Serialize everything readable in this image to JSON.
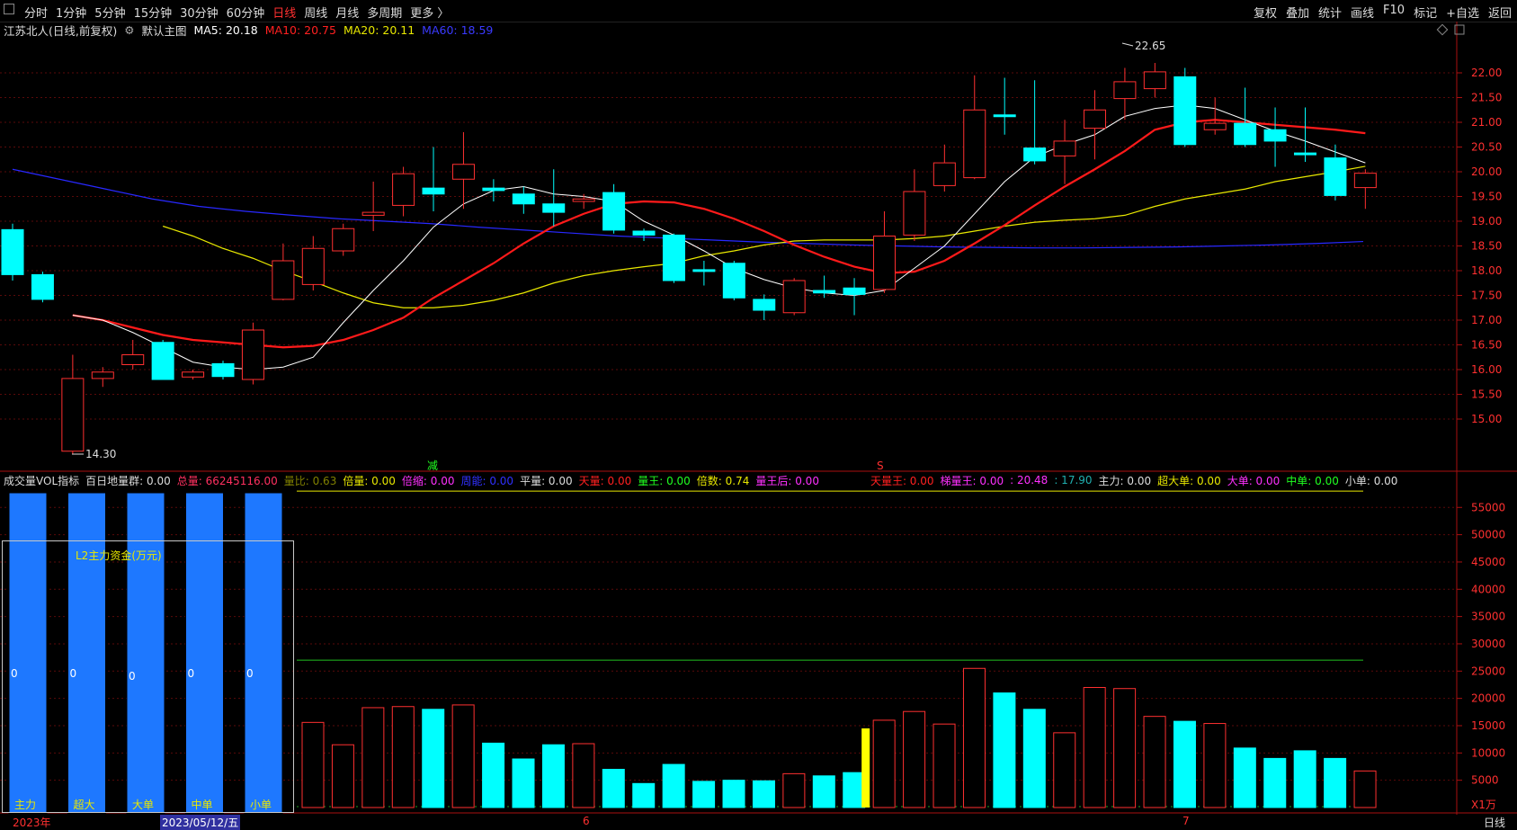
{
  "toolbar": {
    "left_tabs": [
      "分时",
      "1分钟",
      "5分钟",
      "15分钟",
      "30分钟",
      "60分钟",
      "日线",
      "周线",
      "月线",
      "多周期",
      "更多 〉"
    ],
    "active_tab": "日线",
    "right_tabs": [
      "复权",
      "叠加",
      "统计",
      "画线",
      "F10",
      "标记",
      "+自选",
      "返回"
    ]
  },
  "infobar": {
    "title": "江苏北人(日线,前复权)",
    "main_chart_label": "默认主图",
    "ma5": "MA5: 20.18",
    "ma10": "MA10: 20.75",
    "ma20": "MA20: 20.11",
    "ma60": "MA60: 18.59",
    "colors": {
      "ma5": "#ffffff",
      "ma10": "#ff2020",
      "ma20": "#e8e800",
      "ma60": "#3030ff"
    }
  },
  "price_axis": [
    "22.00",
    "21.50",
    "21.00",
    "20.50",
    "20.00",
    "19.50",
    "19.00",
    "18.50",
    "18.00",
    "17.50",
    "17.00",
    "16.50",
    "16.00",
    "15.50",
    "15.00"
  ],
  "annotations": {
    "high": "22.65",
    "low": "14.30",
    "jian": "减",
    "s": "S"
  },
  "indicator_bar": {
    "name": "成交量VOL指标",
    "items": [
      {
        "t": "百日地量群: 0.00",
        "c": "#ddd"
      },
      {
        "t": "总量: 66245116.00",
        "c": "#ff3060"
      },
      {
        "t": "量比: 0.63",
        "c": "#808000"
      },
      {
        "t": "倍量: 0.00",
        "c": "#e8e800"
      },
      {
        "t": "倍缩: 0.00",
        "c": "#ff30ff"
      },
      {
        "t": "周能: 0.00",
        "c": "#3030ff"
      },
      {
        "t": "平量: 0.00",
        "c": "#ddd"
      },
      {
        "t": "天量: 0.00",
        "c": "#ff2020"
      },
      {
        "t": "量王: 0.00",
        "c": "#20ff20"
      },
      {
        "t": "倍数: 0.74",
        "c": "#e8e800"
      },
      {
        "t": "量王后: 0.00",
        "c": "#ff30ff"
      },
      {
        "t": "天量王: 0.00",
        "c": "#ff2020"
      },
      {
        "t": "梯量王: 0.00",
        "c": "#ff30ff"
      },
      {
        "t": ": 20.48",
        "c": "#ff30ff"
      },
      {
        "t": ": 17.90",
        "c": "#20b0b0"
      },
      {
        "t": "主力: 0.00",
        "c": "#ddd"
      },
      {
        "t": "超大单: 0.00",
        "c": "#e8e800"
      },
      {
        "t": "大单: 0.00",
        "c": "#ff30ff"
      },
      {
        "t": "中单: 0.00",
        "c": "#20ff20"
      },
      {
        "t": "小单: 0.00",
        "c": "#ddd"
      }
    ]
  },
  "volume_axis": [
    "55000",
    "50000",
    "45000",
    "40000",
    "35000",
    "30000",
    "25000",
    "20000",
    "15000",
    "10000",
    "5000"
  ],
  "volume_unit": "X1万",
  "l2_panel": {
    "title": "L2主力资金(万元)",
    "bars": [
      {
        "label": "主力",
        "value": "0"
      },
      {
        "label": "超大",
        "value": "0"
      },
      {
        "label": "大单",
        "value": "0"
      },
      {
        "label": "中单",
        "value": "0"
      },
      {
        "label": "小单",
        "value": "0"
      }
    ]
  },
  "bottom": {
    "year": "2023年",
    "date": "2023/05/12/五",
    "m6": "6",
    "m7": "7",
    "period": "日线"
  },
  "chart_data": {
    "type": "candlestick",
    "y_range": [
      14.3,
      22.65
    ],
    "candles": [
      [
        18.83,
        17.92,
        18.95,
        17.8,
        "d"
      ],
      [
        17.92,
        17.42,
        17.98,
        17.36,
        "d"
      ],
      [
        15.82,
        14.35,
        16.3,
        14.3,
        "u"
      ],
      [
        15.82,
        15.95,
        16.05,
        15.65,
        "u"
      ],
      [
        16.1,
        16.3,
        16.6,
        16.0,
        "u"
      ],
      [
        16.55,
        15.8,
        16.6,
        15.8,
        "d"
      ],
      [
        15.85,
        15.95,
        16.0,
        15.8,
        "u"
      ],
      [
        16.12,
        15.86,
        16.18,
        15.8,
        "d"
      ],
      [
        15.8,
        16.8,
        16.95,
        15.7,
        "u"
      ],
      [
        17.42,
        18.2,
        18.55,
        17.4,
        "u"
      ],
      [
        17.72,
        18.45,
        18.7,
        17.6,
        "u"
      ],
      [
        18.4,
        18.85,
        18.95,
        18.3,
        "u"
      ],
      [
        19.12,
        19.18,
        19.8,
        18.8,
        "u"
      ],
      [
        19.32,
        19.96,
        20.1,
        19.1,
        "u"
      ],
      [
        19.67,
        19.55,
        20.5,
        19.2,
        "d"
      ],
      [
        19.85,
        20.15,
        20.8,
        19.25,
        "u"
      ],
      [
        19.67,
        19.62,
        19.85,
        19.4,
        "d"
      ],
      [
        19.55,
        19.35,
        19.7,
        19.15,
        "d"
      ],
      [
        19.35,
        19.18,
        20.05,
        18.9,
        "d"
      ],
      [
        19.4,
        19.45,
        19.55,
        19.25,
        "u"
      ],
      [
        19.58,
        18.82,
        19.75,
        18.75,
        "d"
      ],
      [
        18.8,
        18.72,
        18.85,
        18.6,
        "d"
      ],
      [
        18.72,
        17.8,
        18.75,
        17.75,
        "d"
      ],
      [
        18.02,
        18.0,
        18.2,
        17.7,
        "d"
      ],
      [
        18.15,
        17.45,
        18.2,
        17.4,
        "d"
      ],
      [
        17.42,
        17.2,
        17.52,
        17.0,
        "d"
      ],
      [
        17.15,
        17.8,
        17.85,
        17.1,
        "u"
      ],
      [
        17.6,
        17.55,
        17.9,
        17.45,
        "d"
      ],
      [
        17.65,
        17.52,
        17.85,
        17.1,
        "d"
      ],
      [
        17.62,
        18.7,
        19.2,
        17.55,
        "u"
      ],
      [
        18.72,
        19.6,
        20.05,
        18.6,
        "u"
      ],
      [
        19.72,
        20.18,
        20.55,
        19.6,
        "u"
      ],
      [
        19.88,
        21.25,
        21.95,
        19.85,
        "u"
      ],
      [
        21.15,
        21.12,
        21.9,
        20.75,
        "d"
      ],
      [
        20.48,
        20.22,
        21.85,
        20.15,
        "d"
      ],
      [
        20.32,
        20.62,
        21.05,
        19.75,
        "u"
      ],
      [
        20.88,
        21.25,
        21.65,
        20.25,
        "u"
      ],
      [
        21.48,
        21.82,
        22.1,
        21.05,
        "u"
      ],
      [
        21.68,
        22.02,
        22.2,
        21.5,
        "u"
      ],
      [
        21.92,
        20.55,
        22.1,
        20.5,
        "d"
      ],
      [
        20.85,
        20.98,
        21.5,
        20.75,
        "u"
      ],
      [
        20.98,
        20.55,
        21.7,
        20.5,
        "d"
      ],
      [
        20.85,
        20.62,
        21.3,
        20.1,
        "d"
      ],
      [
        20.38,
        20.36,
        21.3,
        20.2,
        "d"
      ],
      [
        20.28,
        19.52,
        20.55,
        19.42,
        "d"
      ],
      [
        19.68,
        19.97,
        20.05,
        19.25,
        "u"
      ]
    ],
    "ma5": [
      17.1,
      17.0,
      16.75,
      16.45,
      16.15,
      16.05,
      16.0,
      16.05,
      16.25,
      16.95,
      17.6,
      18.2,
      18.88,
      19.35,
      19.62,
      19.7,
      19.55,
      19.5,
      19.4,
      19.0,
      18.72,
      18.4,
      18.05,
      17.82,
      17.65,
      17.55,
      17.5,
      17.6,
      18.05,
      18.5,
      19.15,
      19.8,
      20.3,
      20.55,
      20.75,
      21.12,
      21.28,
      21.35,
      21.28,
      21.05,
      20.82,
      20.62,
      20.4,
      20.18
    ],
    "ma10": [
      17.1,
      17.0,
      16.85,
      16.7,
      16.6,
      16.55,
      16.5,
      16.45,
      16.48,
      16.6,
      16.8,
      17.05,
      17.45,
      17.8,
      18.15,
      18.55,
      18.9,
      19.15,
      19.35,
      19.4,
      19.38,
      19.25,
      19.05,
      18.8,
      18.52,
      18.28,
      18.08,
      17.95,
      17.98,
      18.2,
      18.55,
      18.92,
      19.32,
      19.7,
      20.05,
      20.42,
      20.85,
      21.0,
      21.05,
      21.0,
      20.95,
      20.9,
      20.85,
      20.78
    ],
    "ma20": [
      18.9,
      18.7,
      18.45,
      18.25,
      18.0,
      17.78,
      17.55,
      17.35,
      17.25,
      17.25,
      17.3,
      17.4,
      17.55,
      17.75,
      17.9,
      18.0,
      18.08,
      18.15,
      18.3,
      18.4,
      18.52,
      18.6,
      18.62,
      18.62,
      18.62,
      18.65,
      18.7,
      18.8,
      18.9,
      18.98,
      19.02,
      19.05,
      19.12,
      19.3,
      19.45,
      19.55,
      19.65,
      19.8,
      19.9,
      20.0,
      20.11
    ],
    "ma60": [
      20.05,
      19.85,
      19.65,
      19.45,
      19.3,
      19.2,
      19.12,
      19.05,
      19.0,
      18.95,
      18.88,
      18.82,
      18.76,
      18.7,
      18.66,
      18.62,
      18.58,
      18.55,
      18.52,
      18.5,
      18.48,
      18.47,
      18.46,
      18.46,
      18.47,
      18.48,
      18.5,
      18.52,
      18.55,
      18.59
    ],
    "volume": {
      "y_range": [
        0,
        59000
      ],
      "line_high": 58000,
      "line_mid": 27000,
      "bars": [
        [
          15600,
          "u"
        ],
        [
          11500,
          "u"
        ],
        [
          18300,
          "u"
        ],
        [
          18500,
          "u"
        ],
        [
          18000,
          "d"
        ],
        [
          18800,
          "u"
        ],
        [
          11800,
          "d"
        ],
        [
          8900,
          "d"
        ],
        [
          11500,
          "d"
        ],
        [
          11700,
          "u"
        ],
        [
          7000,
          "d"
        ],
        [
          4400,
          "d"
        ],
        [
          7900,
          "d"
        ],
        [
          4800,
          "d"
        ],
        [
          5000,
          "d"
        ],
        [
          4900,
          "d"
        ],
        [
          6200,
          "u"
        ],
        [
          5800,
          "d"
        ],
        [
          6400,
          "d"
        ],
        [
          16000,
          "u"
        ],
        [
          17600,
          "u"
        ],
        [
          15300,
          "u"
        ],
        [
          25500,
          "u"
        ],
        [
          21000,
          "d"
        ],
        [
          18000,
          "d"
        ],
        [
          13700,
          "u"
        ],
        [
          22000,
          "u"
        ],
        [
          21800,
          "u"
        ],
        [
          16700,
          "u"
        ],
        [
          15800,
          "d"
        ],
        [
          15400,
          "u"
        ],
        [
          10900,
          "d"
        ],
        [
          9000,
          "d"
        ],
        [
          10400,
          "d"
        ],
        [
          9000,
          "d"
        ],
        [
          6700,
          "u"
        ]
      ],
      "yellow_bar": {
        "slot": 19,
        "value": 14500
      }
    }
  }
}
